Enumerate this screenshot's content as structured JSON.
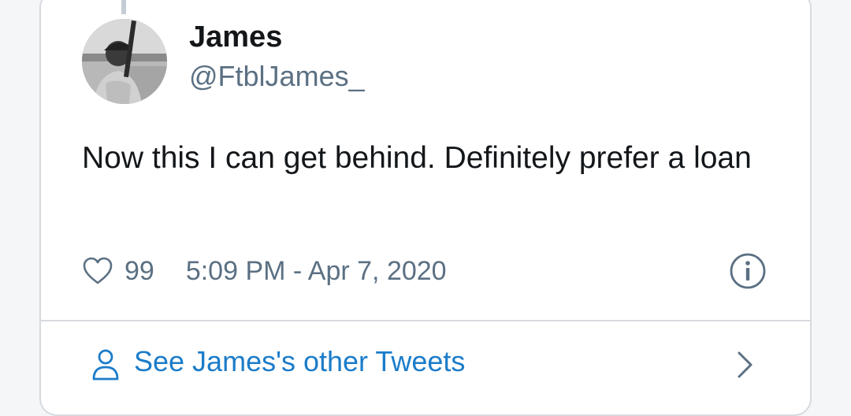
{
  "author": {
    "name": "James",
    "handle": "@FtblJames_"
  },
  "tweet": {
    "text": "Now this I can get behind. Definitely prefer a loan",
    "likes": "99",
    "timestamp": "5:09 PM - Apr 7, 2020"
  },
  "footer": {
    "other_tweets_label": "See James's other Tweets"
  },
  "icons": {
    "like": "heart-icon",
    "info": "info-icon",
    "profile": "person-icon",
    "navigate": "chevron-right-icon"
  },
  "colors": {
    "text_primary": "#14171a",
    "text_secondary": "#5b7083",
    "link": "#1b7cc9",
    "border": "#d7dbdf"
  }
}
